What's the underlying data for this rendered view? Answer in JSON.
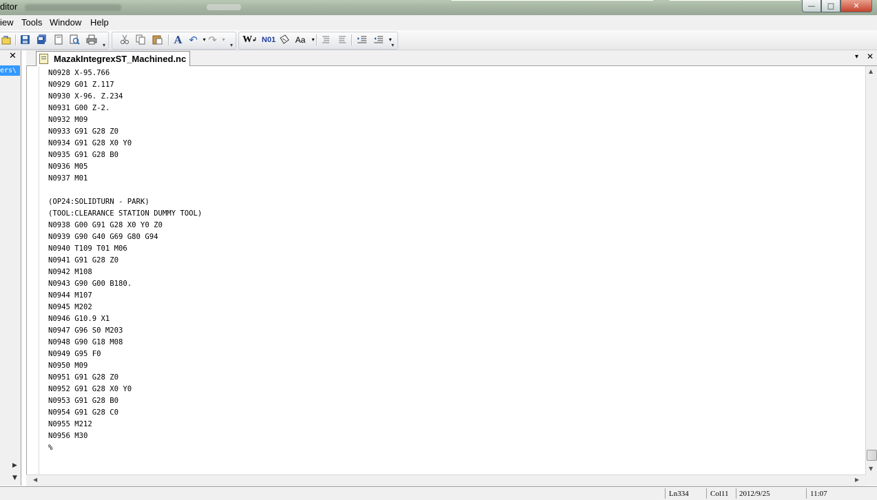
{
  "window": {
    "title": "ditor",
    "controls": [
      "—",
      "□",
      "✕"
    ]
  },
  "menu": {
    "items": [
      "iew",
      "Tools",
      "Window",
      "Help"
    ]
  },
  "left_panel": {
    "close_glyph": "✕",
    "selected_item": "ers\\"
  },
  "tab": {
    "label": "MazakIntegrexST_Machined.nc",
    "dropdown_glyph": "▾",
    "close_glyph": "✕"
  },
  "code_lines": [
    "N0928 X-95.766",
    "N0929 G01 Z.117",
    "N0930 X-96. Z.234",
    "N0931 G00 Z-2.",
    "N0932 M09",
    "N0933 G91 G28 Z0",
    "N0934 G91 G28 X0 Y0",
    "N0935 G91 G28 B0",
    "N0936 M05",
    "N0937 M01",
    "",
    "(OP24:SOLIDTURN - PARK)",
    "(TOOL:CLEARANCE STATION DUMMY TOOL)",
    "N0938 G00 G91 G28 X0 Y0 Z0",
    "N0939 G90 G40 G69 G80 G94",
    "N0940 T109 T01 M06",
    "N0941 G91 G28 Z0",
    "N0942 M108",
    "N0943 G90 G00 B180.",
    "N0944 M107",
    "N0945 M202",
    "N0946 G10.9 X1",
    "N0947 G96 S0 M203",
    "N0948 G90 G18 M08",
    "N0949 G95 F0",
    "N0950 M09",
    "N0951 G91 G28 Z0",
    "N0952 G91 G28 X0 Y0",
    "N0953 G91 G28 B0",
    "N0954 G91 G28 C0",
    "N0955 M212",
    "N0956 M30",
    "%"
  ],
  "status": {
    "line": "Ln334",
    "col": "Col11",
    "date": "2012/9/25",
    "time": "11:07"
  },
  "toolbar": {
    "word_wrap_label": "W",
    "line_number_label": "N01",
    "font_label": "A",
    "case_label": "Aa"
  },
  "colors": {
    "selection": "#3399ff",
    "close_button": "#c5432c"
  }
}
